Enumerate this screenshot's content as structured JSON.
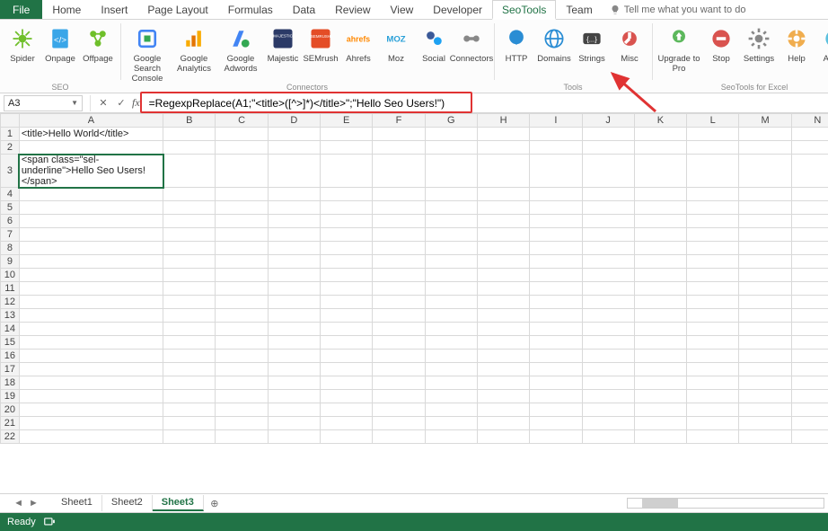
{
  "tabs": {
    "file": "File",
    "items": [
      "Home",
      "Insert",
      "Page Layout",
      "Formulas",
      "Data",
      "Review",
      "View",
      "Developer",
      "SeoTools",
      "Team"
    ],
    "active": "SeoTools",
    "tellme": "Tell me what you want to do"
  },
  "ribbon": {
    "groups": [
      {
        "label": "SEO",
        "buttons": [
          {
            "key": "spider",
            "label": "Spider",
            "color": "#6fbf2a"
          },
          {
            "key": "onpage",
            "label": "Onpage",
            "color": "#3aa6e8"
          },
          {
            "key": "offpage",
            "label": "Offpage",
            "color": "#6fbf2a"
          }
        ]
      },
      {
        "label": "Connectors",
        "buttons": [
          {
            "key": "gsc",
            "label": "Google Search Console"
          },
          {
            "key": "ga",
            "label": "Google Analytics"
          },
          {
            "key": "gaw",
            "label": "Google Adwords"
          },
          {
            "key": "majestic",
            "label": "Majestic"
          },
          {
            "key": "semrush",
            "label": "SEMrush"
          },
          {
            "key": "ahrefs",
            "label": "Ahrefs"
          },
          {
            "key": "moz",
            "label": "Moz"
          },
          {
            "key": "social",
            "label": "Social"
          },
          {
            "key": "connectors",
            "label": "Connectors"
          }
        ]
      },
      {
        "label": "Tools",
        "buttons": [
          {
            "key": "http",
            "label": "HTTP"
          },
          {
            "key": "domains",
            "label": "Domains"
          },
          {
            "key": "strings",
            "label": "Strings"
          },
          {
            "key": "misc",
            "label": "Misc"
          }
        ]
      },
      {
        "label": "SeoTools for Excel",
        "buttons": [
          {
            "key": "upgrade",
            "label": "Upgrade to Pro"
          },
          {
            "key": "stop",
            "label": "Stop"
          },
          {
            "key": "settings",
            "label": "Settings"
          },
          {
            "key": "help",
            "label": "Help"
          },
          {
            "key": "about",
            "label": "About"
          }
        ]
      }
    ]
  },
  "formula_bar": {
    "name_box": "A3",
    "formula": "=RegexpReplace(A1;\"<title>([^>]*)</title>\";\"Hello Seo Users!\")"
  },
  "grid": {
    "columns": [
      "A",
      "B",
      "C",
      "D",
      "E",
      "F",
      "G",
      "H",
      "I",
      "J",
      "K",
      "L",
      "M",
      "N"
    ],
    "rows": 22,
    "cells": {
      "A1": "<title>Hello World</title>",
      "A3": "Hello Seo Users!"
    },
    "selected": "A3"
  },
  "sheets": {
    "items": [
      "Sheet1",
      "Sheet2",
      "Sheet3"
    ],
    "active": "Sheet3"
  },
  "status": {
    "text": "Ready"
  }
}
